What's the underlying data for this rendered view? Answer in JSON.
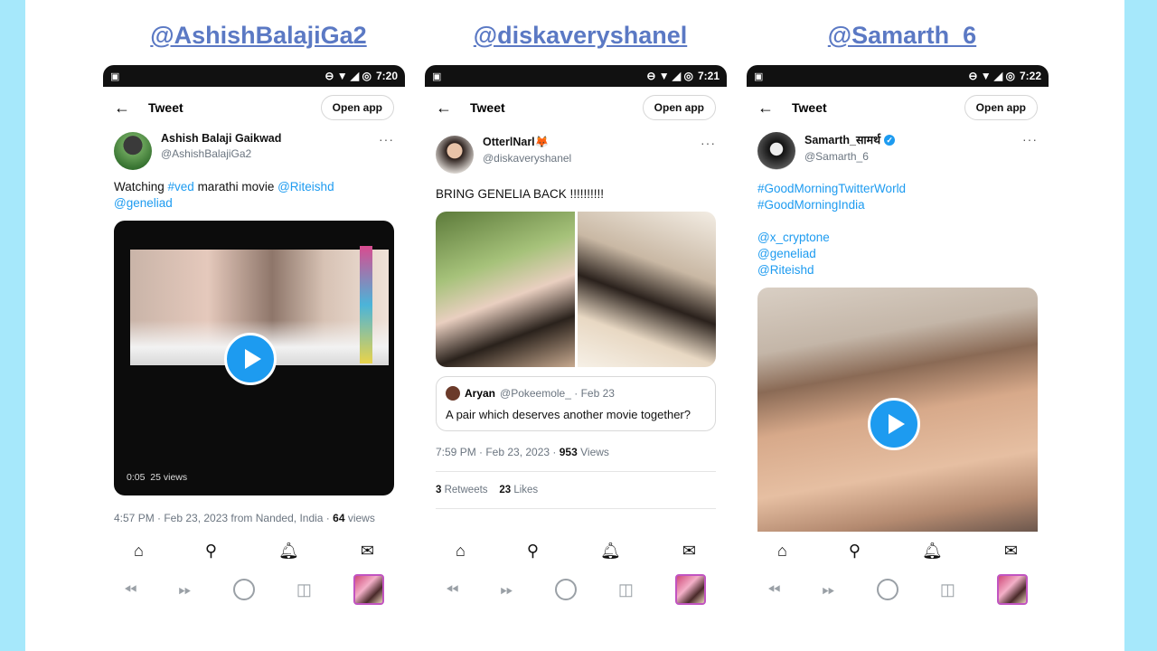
{
  "handles": [
    "@AshishBalajiGa2",
    "@diskaveryshanel",
    "@Samarth_6"
  ],
  "common": {
    "title": "Tweet",
    "open_app": "Open app",
    "back": "←",
    "more": "···"
  },
  "phone1": {
    "time": "7:20",
    "display_name": "Ashish Balaji Gaikwad",
    "username": "@AshishBalajiGa2",
    "text_prefix": "Watching ",
    "hashtag": "#ved",
    "text_mid": " marathi movie ",
    "mention1": "@Riteishd",
    "mention2": "@geneliad",
    "video_time": "0:05",
    "video_views": "25 views",
    "meta_prefix": "4:57 PM · Feb 23, 2023 from Nanded, India · ",
    "meta_views_count": "64",
    "meta_views_label": " views"
  },
  "phone2": {
    "time": "7:21",
    "display_name": "OtterlNarl🦊",
    "username": "@diskaveryshanel",
    "text": "BRING GENELIA BACK !!!!!!!!!!",
    "quote_name": "Aryan",
    "quote_handle": "@Pokeemole_ · Feb 23",
    "quote_text": "A pair which deserves another movie together?",
    "meta_prefix": "7:59 PM · Feb 23, 2023 · ",
    "meta_views_count": "953",
    "meta_views_label": " Views",
    "retweets_count": "3",
    "retweets_label": " Retweets",
    "likes_count": "23",
    "likes_label": " Likes"
  },
  "phone3": {
    "time": "7:22",
    "display_name": "Samarth_सामर्थ",
    "username": "@Samarth_6",
    "lines": [
      "#GoodMorningTwitterWorld",
      "#GoodMorningIndia",
      "",
      "@x_cryptone",
      "@geneliad",
      "@Riteishd"
    ]
  },
  "colors": {
    "link": "#1d9bf0",
    "handle_heading": "#5b79c4",
    "background_frame": "#a6e8fb"
  }
}
